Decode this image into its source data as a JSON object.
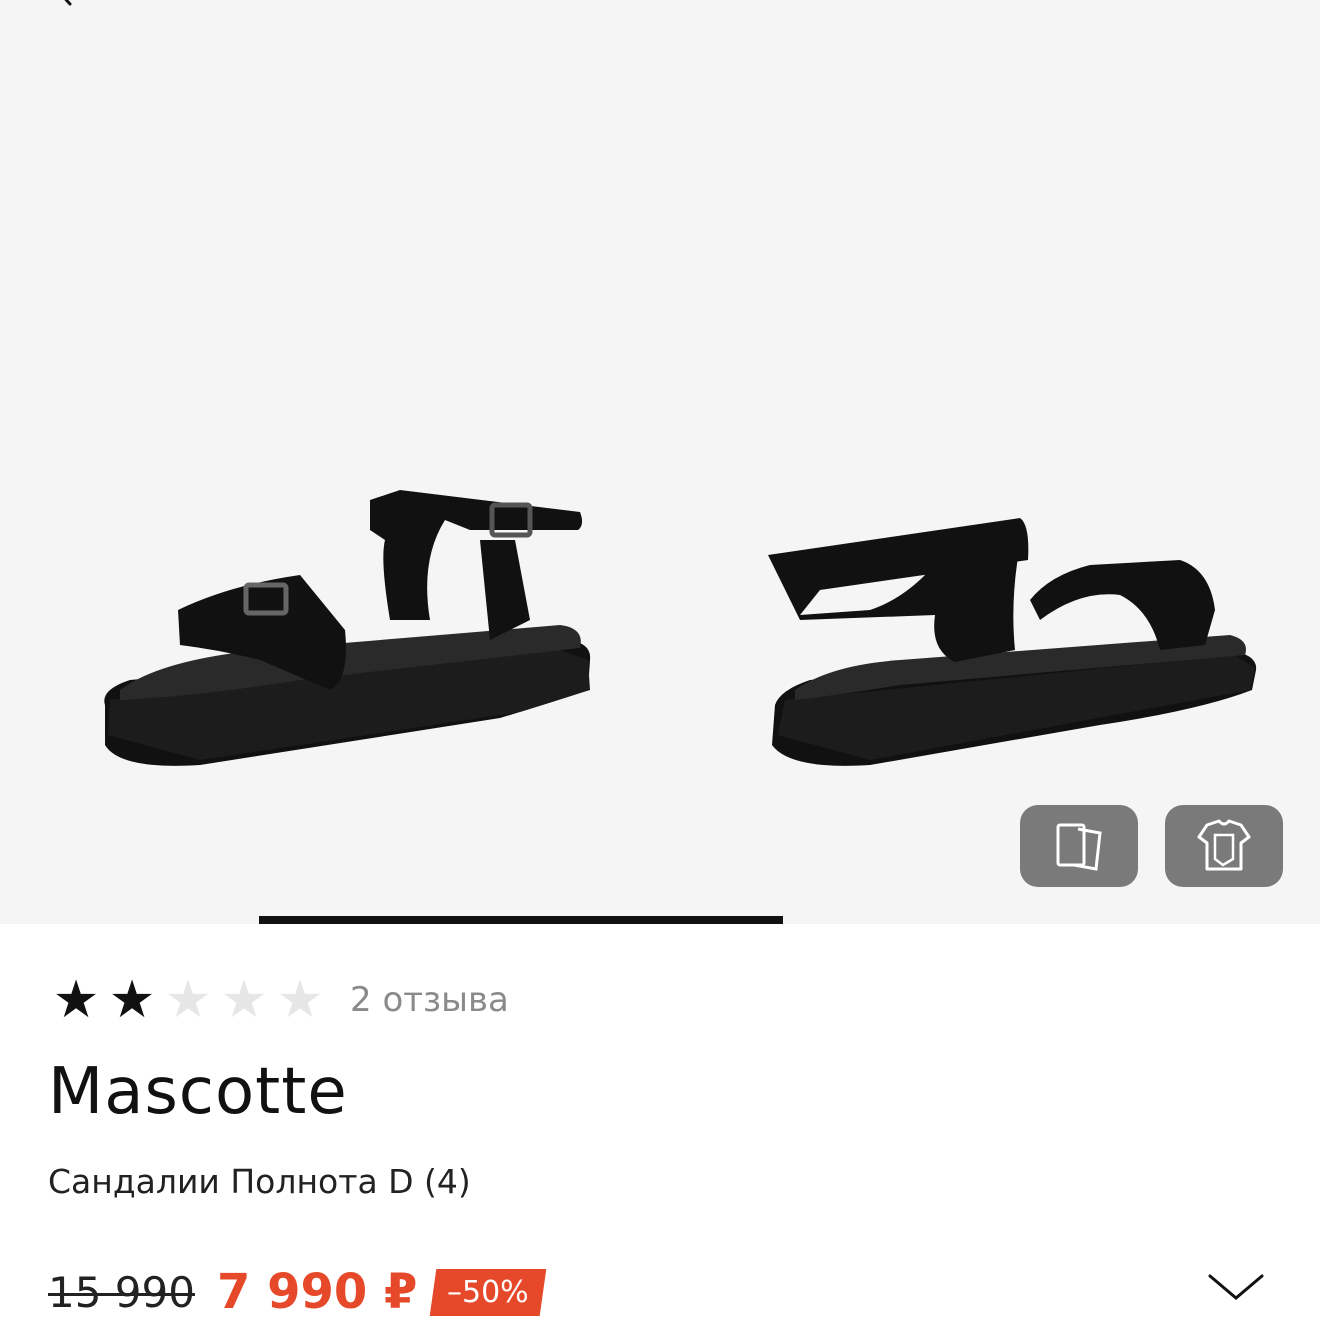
{
  "rating": {
    "filled": 2,
    "total": 5,
    "reviews_label": "2 отзыва"
  },
  "product": {
    "brand": "Mascotte",
    "name": "Сандалии Полнота D (4)"
  },
  "price": {
    "old": "15 990",
    "current": "7 990 ₽",
    "discount": "–50%"
  },
  "gallery": {
    "progress_fraction_start": 0.196,
    "progress_fraction_end": 0.593
  },
  "colors": {
    "accent": "#e6492a",
    "gallery_bg": "#f5f5f5",
    "float_button_bg": "#7a7a7a"
  },
  "icons": {
    "back": "arrow-left-icon",
    "compare": "pages-icon",
    "outfit": "shirt-icon",
    "expand": "chevron-down-icon"
  }
}
